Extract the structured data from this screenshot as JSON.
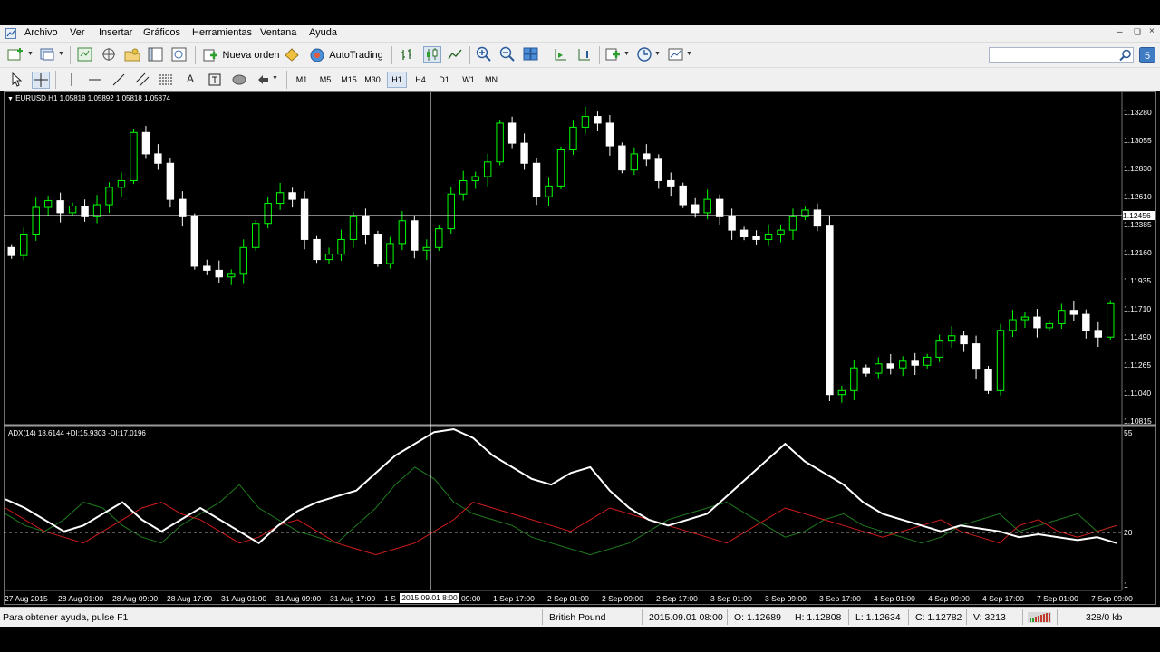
{
  "menu": [
    "Archivo",
    "Ver",
    "Insertar",
    "Gráficos",
    "Herramientas",
    "Ventana",
    "Ayuda"
  ],
  "toolbar": {
    "new_order_label": "Nueva orden",
    "autotrading_label": "AutoTrading",
    "timeframes": [
      "M1",
      "M5",
      "M15",
      "M30",
      "H1",
      "H4",
      "D1",
      "W1",
      "MN"
    ],
    "active_timeframe": "H1"
  },
  "chart": {
    "header": "EURUSD,H1  1.05818 1.05892 1.05818 1.05874",
    "indicator_header": "ADX(14) 18.6144 +DI:15.9303 -DI:17.0196",
    "price_labels": [
      "1.13280",
      "1.13055",
      "1.12830",
      "1.12610",
      "1.12385",
      "1.12160",
      "1.11935",
      "1.11710",
      "1.11490",
      "1.11265",
      "1.11040",
      "1.10815"
    ],
    "crosshair_price": "1.12456",
    "crosshair_time": "2015.09.01 8:00",
    "indicator_levels": [
      "55",
      "20",
      "1"
    ],
    "time_labels": [
      "27 Aug 2015",
      "28 Aug 01:00",
      "28 Aug 09:00",
      "28 Aug 17:00",
      "31 Aug 01:00",
      "31 Aug 09:00",
      "31 Aug 17:00",
      "1 S",
      "09:00",
      "1 Sep 17:00",
      "2 Sep 01:00",
      "2 Sep 09:00",
      "2 Sep 17:00",
      "3 Sep 01:00",
      "3 Sep 09:00",
      "3 Sep 17:00",
      "4 Sep 01:00",
      "4 Sep 09:00",
      "4 Sep 17:00",
      "7 Sep 01:00",
      "7 Sep 09:00"
    ],
    "colors": {
      "bull": "#00ff00",
      "bear": "#ffffff",
      "adx": "#ffffff",
      "plus_di": "#1f7a1f",
      "minus_di": "#d01c1c"
    }
  },
  "chart_data": {
    "type": "candlestick",
    "symbol": "EURUSD",
    "timeframe": "H1",
    "ylim": [
      1.10815,
      1.1328
    ],
    "close": [
      1.1206,
      1.1222,
      1.1242,
      1.1247,
      1.1238,
      1.1243,
      1.1235,
      1.1244,
      1.1257,
      1.1262,
      1.1298,
      1.1282,
      1.1275,
      1.1248,
      1.1235,
      1.1198,
      1.1195,
      1.119,
      1.1192,
      1.1212,
      1.123,
      1.1245,
      1.1253,
      1.1248,
      1.1218,
      1.1203,
      1.1207,
      1.1218,
      1.1235,
      1.1222,
      1.12,
      1.1215,
      1.1232,
      1.121,
      1.1212,
      1.1226,
      1.1252,
      1.1262,
      1.1265,
      1.1276,
      1.1305,
      1.129,
      1.1275,
      1.125,
      1.1258,
      1.1285,
      1.1302,
      1.131,
      1.1305,
      1.1288,
      1.127,
      1.1282,
      1.1278,
      1.1262,
      1.1258,
      1.1244,
      1.1238,
      1.1248,
      1.1235,
      1.1225,
      1.122,
      1.1218,
      1.1222,
      1.1225,
      1.1235,
      1.124,
      1.1228,
      1.1102,
      1.1105,
      1.1122,
      1.1118,
      1.1125,
      1.1122,
      1.1127,
      1.1124,
      1.113,
      1.1142,
      1.1146,
      1.114,
      1.1121,
      1.1105,
      1.115,
      1.1158,
      1.116,
      1.1152,
      1.1155,
      1.1165,
      1.1162,
      1.115,
      1.1145,
      1.117
    ],
    "adx": [
      31,
      28,
      24,
      20,
      22,
      26,
      30,
      24,
      20,
      24,
      28,
      24,
      20,
      16,
      22,
      27,
      30,
      32,
      34,
      40,
      46,
      50,
      54,
      55,
      52,
      46,
      42,
      38,
      36,
      40,
      42,
      34,
      28,
      24,
      22,
      24,
      26,
      32,
      38,
      44,
      50,
      44,
      40,
      36,
      30,
      26,
      24,
      22,
      20,
      22,
      21,
      20,
      18,
      19,
      18,
      17,
      18,
      16
    ],
    "plus_di": [
      26,
      22,
      20,
      24,
      30,
      28,
      22,
      18,
      16,
      22,
      26,
      30,
      36,
      28,
      24,
      20,
      18,
      16,
      22,
      28,
      36,
      42,
      38,
      30,
      26,
      24,
      22,
      18,
      16,
      14,
      12,
      14,
      16,
      20,
      24,
      26,
      28,
      30,
      26,
      22,
      18,
      20,
      24,
      26,
      22,
      20,
      18,
      16,
      18,
      22,
      24,
      26,
      20,
      22,
      24,
      26,
      20,
      22
    ],
    "minus_di": [
      28,
      24,
      20,
      18,
      16,
      20,
      24,
      28,
      30,
      26,
      24,
      20,
      16,
      18,
      22,
      24,
      20,
      16,
      14,
      12,
      14,
      16,
      20,
      24,
      30,
      28,
      26,
      24,
      22,
      20,
      24,
      28,
      26,
      24,
      22,
      20,
      18,
      16,
      20,
      24,
      28,
      26,
      24,
      22,
      20,
      18,
      20,
      22,
      24,
      20,
      18,
      16,
      22,
      24,
      20,
      18,
      20,
      22
    ]
  },
  "status": {
    "help": "Para obtener ayuda, pulse F1",
    "profile": "British Pound",
    "datetime": "2015.09.01 08:00",
    "open": "O: 1.12689",
    "high": "H: 1.12808",
    "low": "L: 1.12634",
    "close": "C: 1.12782",
    "volume": "V: 3213",
    "traffic": "328/0 kb"
  }
}
